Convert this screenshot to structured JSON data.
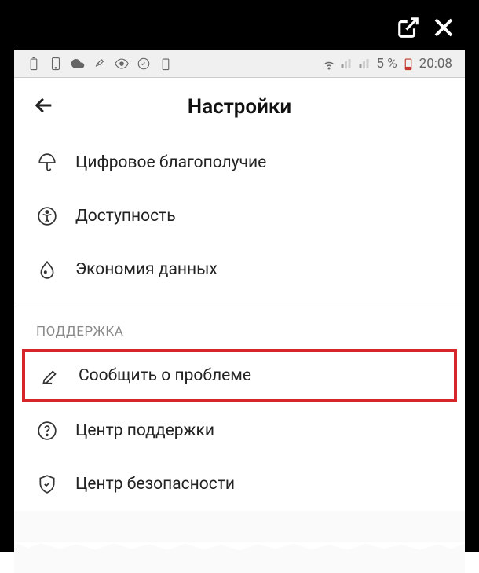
{
  "status_bar": {
    "battery_percent": "5 %",
    "time": "20:08"
  },
  "header": {
    "title": "Настройки"
  },
  "menu_items": [
    {
      "label": "Цифровое благополучие"
    },
    {
      "label": "Доступность"
    },
    {
      "label": "Экономия данных"
    }
  ],
  "support_section": {
    "header": "ПОДДЕРЖКА",
    "items": [
      {
        "label": "Сообщить о проблеме"
      },
      {
        "label": "Центр поддержки"
      },
      {
        "label": "Центр безопасности"
      }
    ]
  }
}
